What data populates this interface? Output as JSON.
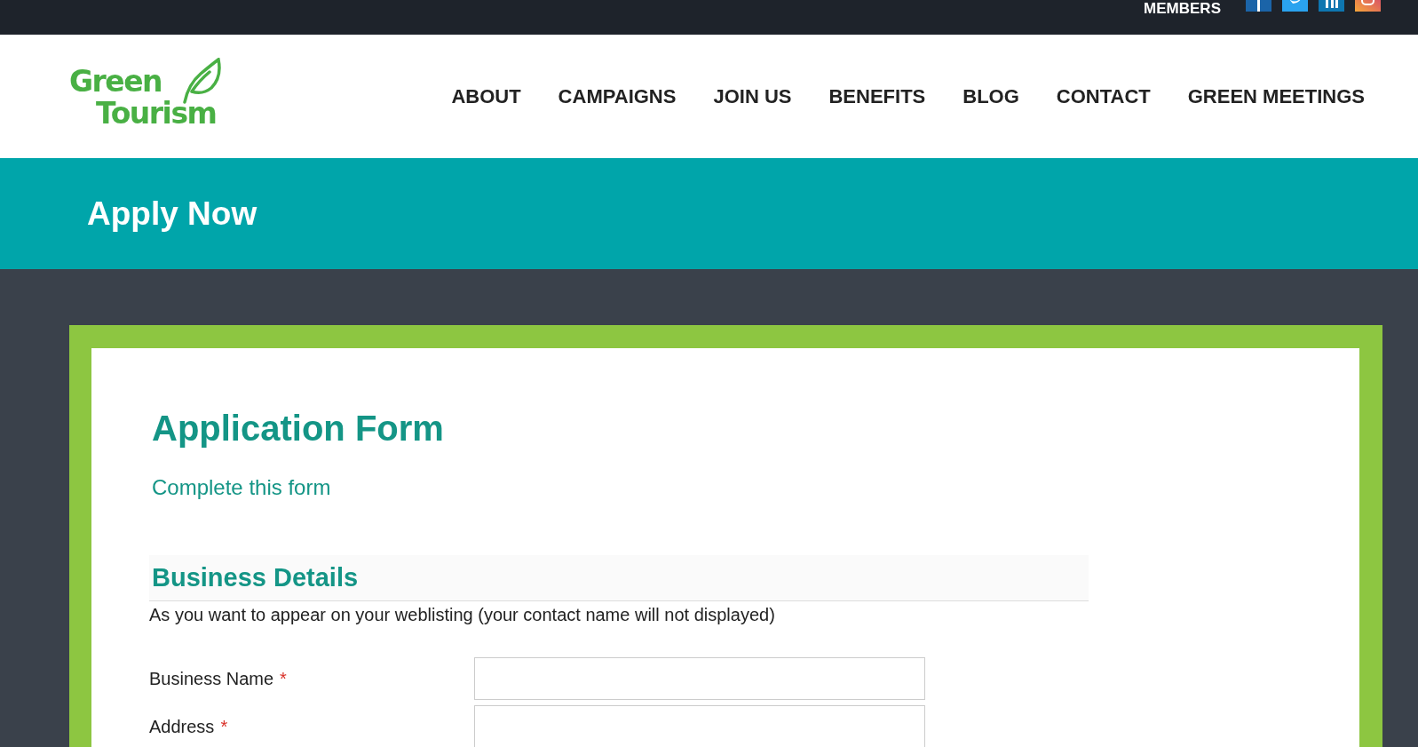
{
  "top_bar": {
    "members_link": "MEMBERS",
    "social": [
      {
        "kind": "facebook"
      },
      {
        "kind": "twitter"
      },
      {
        "kind": "linkedin"
      },
      {
        "kind": "instagram"
      }
    ]
  },
  "header": {
    "logo": [
      "Green",
      "Tourism"
    ],
    "nav": [
      "ABOUT",
      "CAMPAIGNS",
      "JOIN US",
      "BENEFITS",
      "BLOG",
      "CONTACT",
      "GREEN MEETINGS"
    ]
  },
  "banner": {
    "title": "Apply Now"
  },
  "form": {
    "title": "Application Form",
    "subtitle": "Complete this form",
    "section": {
      "title": "Business Details",
      "description": "As you want to appear on your weblisting (your contact name will not displayed)"
    },
    "fields": [
      {
        "label": "Business Name",
        "required_mark": "*"
      },
      {
        "label": "Address",
        "required_mark": "*"
      }
    ]
  }
}
